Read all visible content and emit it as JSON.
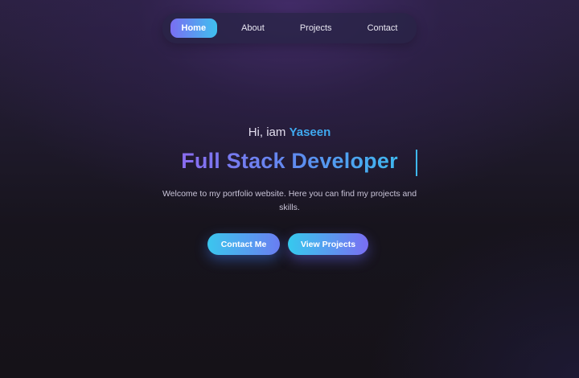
{
  "nav": {
    "items": [
      {
        "label": "Home",
        "active": true
      },
      {
        "label": "About",
        "active": false
      },
      {
        "label": "Projects",
        "active": false
      },
      {
        "label": "Contact",
        "active": false
      }
    ]
  },
  "hero": {
    "greeting_prefix": "Hi, iam",
    "greeting_name": "Yaseen",
    "role": "Full Stack Developer",
    "tagline": "Welcome to my portfolio website. Here you can find my projects and skills.",
    "buttons": {
      "contact_label": "Contact Me",
      "projects_label": "View Projects"
    }
  },
  "colors": {
    "accent_blue": "#3fa9f0",
    "accent_purple": "#7a6ef2",
    "background": "#17141d"
  }
}
